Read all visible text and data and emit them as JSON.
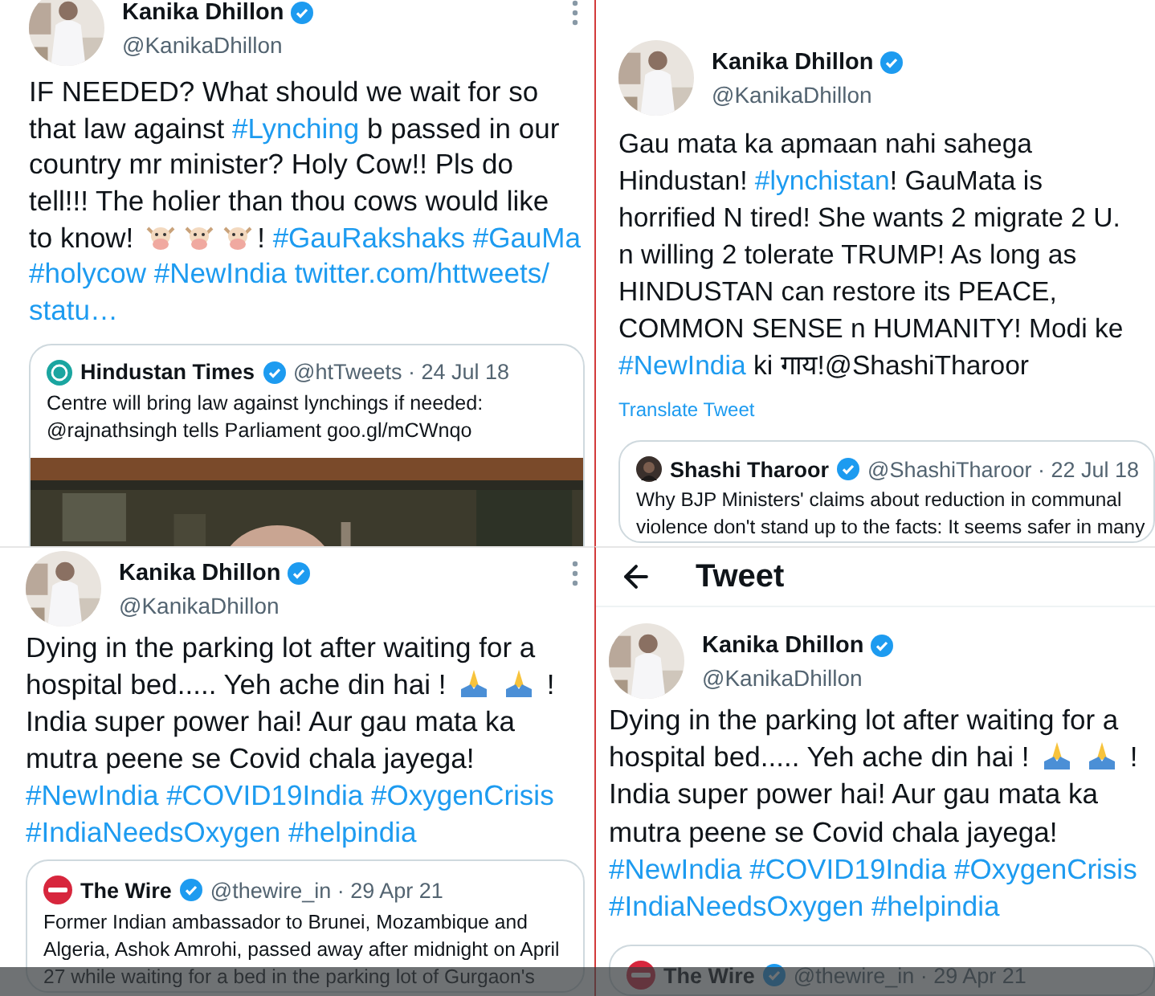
{
  "panels": [
    {
      "menu": true,
      "avatar": {
        "kind": "picture"
      },
      "author": {
        "name": "Kanika Dhillon",
        "handle": "@KanikaDhillon",
        "verified": true
      },
      "body": [
        [
          {
            "kind": "text",
            "text": "IF NEEDED? What should we wait for so"
          }
        ],
        [
          {
            "kind": "text",
            "text": "that law against"
          },
          {
            "kind": "hashtag",
            "text": "#Lynching"
          },
          {
            "kind": "text",
            "text": "b passed in our"
          }
        ],
        [
          {
            "kind": "text",
            "text": "country mr minister? Holy Cow!! Pls do"
          }
        ],
        [
          {
            "kind": "text",
            "text": "tell!!! The holier than thou cows would like"
          }
        ],
        [
          {
            "kind": "text",
            "text": "to know!"
          },
          {
            "kind": "cow"
          },
          {
            "kind": "cow",
            "attached": true
          },
          {
            "kind": "cow",
            "attached": true
          },
          {
            "kind": "text",
            "text": "!",
            "attached": true
          },
          {
            "kind": "hashtag",
            "text": "#GauRakshaks"
          },
          {
            "kind": "hashtag",
            "text": "#GauMa"
          }
        ],
        [
          {
            "kind": "hashtag",
            "text": "#holycow"
          },
          {
            "kind": "hashtag",
            "text": "#NewIndia"
          },
          {
            "kind": "link",
            "text": "twitter.com/httweets/"
          }
        ],
        [
          {
            "kind": "link",
            "text": "statu…"
          }
        ]
      ],
      "quote": {
        "logo": {
          "kind": "ht"
        },
        "name": "Hindustan Times",
        "verified": true,
        "meta": "@htTweets · 24 Jul 18",
        "text": [
          "Centre will bring law against lynchings if needed:",
          "@rajnathsingh tells Parliament goo.gl/mCWnqo"
        ],
        "media": {
          "kind": "picture"
        }
      }
    },
    {
      "avatar": {
        "kind": "picture"
      },
      "author": {
        "name": "Kanika Dhillon",
        "handle": "@KanikaDhillon",
        "verified": true
      },
      "body": [
        [
          {
            "kind": "text",
            "text": "Gau mata ka apmaan nahi sahega"
          }
        ],
        [
          {
            "kind": "text",
            "text": "Hindustan!"
          },
          {
            "kind": "hashtag",
            "text": "#lynchistan"
          },
          {
            "kind": "text",
            "text": "! GauMata is",
            "attached": true
          }
        ],
        [
          {
            "kind": "text",
            "text": "horrified N tired! She wants 2 migrate 2 U."
          }
        ],
        [
          {
            "kind": "text",
            "text": "n willing 2 tolerate TRUMP! As long as"
          }
        ],
        [
          {
            "kind": "text",
            "text": "HINDUSTAN can restore its PEACE,"
          }
        ],
        [
          {
            "kind": "text",
            "text": "COMMON SENSE n HUMANITY! Modi ke"
          }
        ],
        [
          {
            "kind": "hashtag",
            "text": "#NewIndia"
          },
          {
            "kind": "text",
            "text": "ki गाय!@ShashiTharoor"
          }
        ]
      ],
      "translate": "Translate Tweet",
      "quote": {
        "logo": {
          "kind": "picture"
        },
        "name": "Shashi Tharoor",
        "verified": true,
        "meta": "@ShashiTharoor · 22 Jul 18",
        "text": [
          "Why BJP Ministers' claims about reduction in communal",
          "violence don't stand up to the facts: It seems safer in many"
        ]
      }
    },
    {
      "menu": true,
      "avatar": {
        "kind": "picture"
      },
      "author": {
        "name": "Kanika Dhillon",
        "handle": "@KanikaDhillon",
        "verified": true
      },
      "body": [
        [
          {
            "kind": "text",
            "text": "Dying in the parking lot after waiting for a"
          }
        ],
        [
          {
            "kind": "text",
            "text": "hospital bed..... Yeh ache din hai !"
          },
          {
            "kind": "pray"
          },
          {
            "kind": "pray"
          },
          {
            "kind": "text",
            "text": "!"
          }
        ],
        [
          {
            "kind": "text",
            "text": "India super power hai! Aur gau mata ka"
          }
        ],
        [
          {
            "kind": "text",
            "text": "mutra peene se Covid chala jayega!"
          }
        ],
        [
          {
            "kind": "hashtag",
            "text": "#NewIndia"
          },
          {
            "kind": "hashtag",
            "text": "#COVID19India"
          },
          {
            "kind": "hashtag",
            "text": "#OxygenCrisis"
          }
        ],
        [
          {
            "kind": "hashtag",
            "text": "#IndiaNeedsOxygen"
          },
          {
            "kind": "hashtag",
            "text": "#helpindia"
          }
        ]
      ],
      "quote": {
        "logo": {
          "kind": "wire"
        },
        "name": "The Wire",
        "verified": true,
        "meta": "@thewire_in · 29 Apr 21",
        "text": [
          "Former Indian ambassador to Brunei, Mozambique and",
          "Algeria, Ashok Amrohi, passed away after midnight on April",
          "27 while waiting for a bed in the parking lot of Gurgaon's"
        ]
      }
    },
    {
      "header": {
        "back": true,
        "title": "Tweet"
      },
      "avatar": {
        "kind": "picture"
      },
      "author": {
        "name": "Kanika Dhillon",
        "handle": "@KanikaDhillon",
        "verified": true
      },
      "body": [
        [
          {
            "kind": "text",
            "text": "Dying in the parking lot after waiting for a"
          }
        ],
        [
          {
            "kind": "text",
            "text": "hospital bed..... Yeh ache din hai !"
          },
          {
            "kind": "pray"
          },
          {
            "kind": "pray"
          },
          {
            "kind": "text",
            "text": "!"
          }
        ],
        [
          {
            "kind": "text",
            "text": "India super power hai! Aur gau mata ka"
          }
        ],
        [
          {
            "kind": "text",
            "text": "mutra peene se Covid chala jayega!"
          }
        ],
        [
          {
            "kind": "hashtag",
            "text": "#NewIndia"
          },
          {
            "kind": "hashtag",
            "text": "#COVID19India"
          },
          {
            "kind": "hashtag",
            "text": "#OxygenCrisis"
          }
        ],
        [
          {
            "kind": "hashtag",
            "text": "#IndiaNeedsOxygen"
          },
          {
            "kind": "hashtag",
            "text": "#helpindia"
          }
        ]
      ],
      "quote": {
        "logo": {
          "kind": "wire"
        },
        "name": "The Wire",
        "verified": true,
        "meta": "@thewire_in · 29 Apr 21"
      }
    }
  ],
  "shade_bar": true
}
